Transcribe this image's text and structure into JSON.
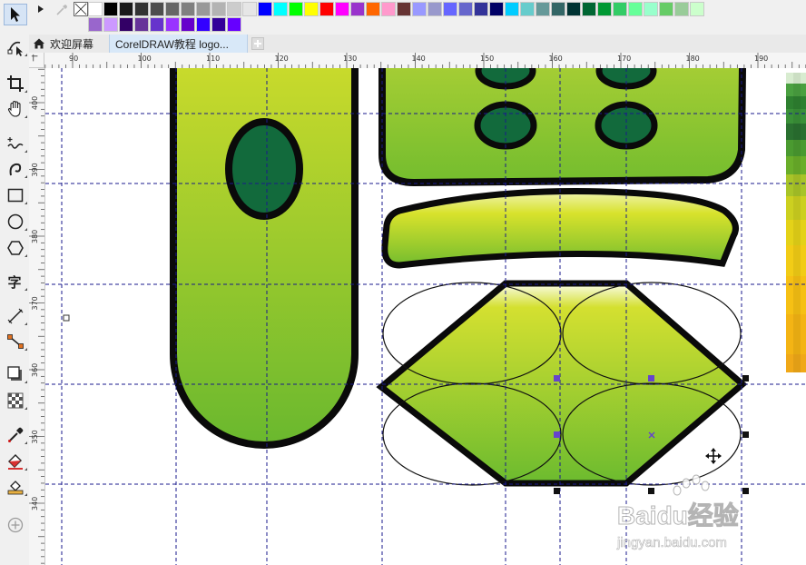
{
  "tabs": {
    "welcome": "欢迎屏幕",
    "document": "CorelDRAW教程 logo..."
  },
  "palette": {
    "row1": [
      "#ffffff",
      "#000000",
      "#1a1a1a",
      "#333333",
      "#4d4d4d",
      "#666666",
      "#808080",
      "#999999",
      "#b3b3b3",
      "#cccccc",
      "#e6e6e6",
      "#0000ff",
      "#00ffff",
      "#00ff00",
      "#ffff00",
      "#ff0000",
      "#ff00ff",
      "#9933cc",
      "#ff6600",
      "#ff99cc",
      "#663333",
      "#9999ff",
      "#9999cc",
      "#6666ff",
      "#6666cc",
      "#333399",
      "#000066",
      "#00ccff",
      "#66cccc",
      "#669999",
      "#336666",
      "#003333",
      "#006633",
      "#009933",
      "#33cc66",
      "#66ff99",
      "#99ffcc",
      "#66cc66",
      "#99cc99",
      "#ccffcc"
    ],
    "row2": [
      "#9966cc",
      "#cc99ff",
      "#330066",
      "#663399",
      "#6633cc",
      "#9933ff",
      "#6600cc",
      "#3300ff",
      "#330099",
      "#6600ff"
    ]
  },
  "rulers": {
    "horizontal_ticks": [
      "90",
      "100",
      "110",
      "120",
      "130",
      "140",
      "150",
      "160",
      "170",
      "180",
      "190"
    ],
    "vertical_ticks": [
      "400",
      "390",
      "380",
      "370",
      "360",
      "350",
      "340"
    ]
  },
  "watermark": {
    "brand": "Baidu经验",
    "url": "jingyan.baidu.com"
  }
}
